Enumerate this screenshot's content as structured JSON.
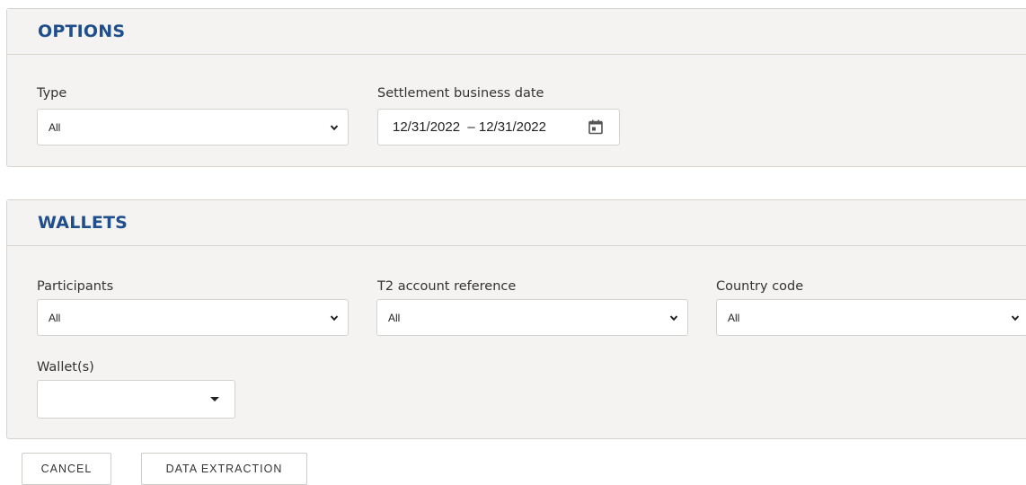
{
  "options": {
    "title": "OPTIONS",
    "type_label": "Type",
    "type_value": "All",
    "date_label": "Settlement business date",
    "date_value": "12/31/2022  – 12/31/2022"
  },
  "wallets": {
    "title": "WALLETS",
    "participants_label": "Participants",
    "participants_value": "All",
    "t2_label": "T2 account reference",
    "t2_value": "All",
    "country_label": "Country code",
    "country_value": "All",
    "wallet_label": "Wallet(s)",
    "wallet_value": ""
  },
  "actions": {
    "cancel_label": "CANCEL",
    "extract_label": "DATA EXTRACTION"
  },
  "colors": {
    "title": "#1f4e8c",
    "panel_bg": "#f4f3f1"
  }
}
